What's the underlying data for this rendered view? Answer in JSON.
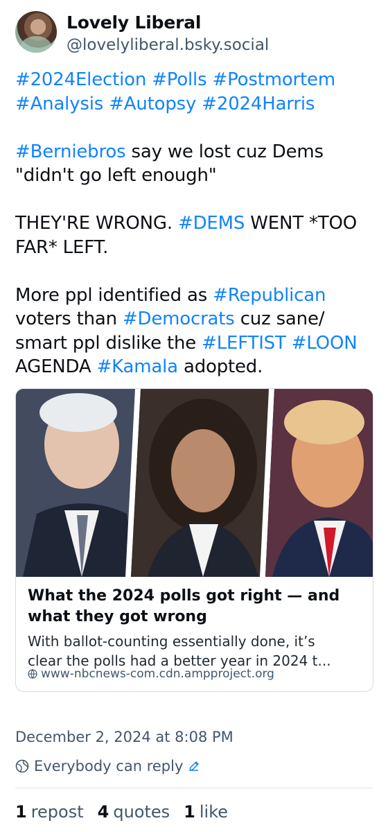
{
  "author": {
    "display_name": "Lovely Liberal",
    "handle": "@lovelyliberal.bsky.social"
  },
  "post": {
    "p1": [
      {
        "t": "#2024Election",
        "tag": true
      },
      {
        "t": " ",
        "tag": false
      },
      {
        "t": "#Polls",
        "tag": true
      },
      {
        "t": " ",
        "tag": false
      },
      {
        "t": "#Postmortem",
        "tag": true
      },
      {
        "t": " ",
        "tag": false
      },
      {
        "t": "#Analysis",
        "tag": true
      },
      {
        "t": " ",
        "tag": false
      },
      {
        "t": "#Autopsy",
        "tag": true
      },
      {
        "t": " ",
        "tag": false
      },
      {
        "t": "#2024Harris",
        "tag": true
      }
    ],
    "p2": [
      {
        "t": "#Berniebros",
        "tag": true
      },
      {
        "t": " say we lost cuz Dems \"didn't go left enough\"",
        "tag": false
      }
    ],
    "p3": [
      {
        "t": "THEY'RE WRONG. ",
        "tag": false
      },
      {
        "t": "#DEMS",
        "tag": true
      },
      {
        "t": " WENT *TOO FAR* LEFT.",
        "tag": false
      }
    ],
    "p4": [
      {
        "t": "More ppl identified as ",
        "tag": false
      },
      {
        "t": "#Republican",
        "tag": true
      },
      {
        "t": " voters than ",
        "tag": false
      },
      {
        "t": "#Democrats",
        "tag": true
      },
      {
        "t": " cuz sane/ smart ppl dislike the ",
        "tag": false
      },
      {
        "t": "#LEFTIST",
        "tag": true
      },
      {
        "t": " ",
        "tag": false
      },
      {
        "t": "#LOON",
        "tag": true
      },
      {
        "t": " AGENDA ",
        "tag": false
      },
      {
        "t": "#Kamala",
        "tag": true
      },
      {
        "t": " adopted.",
        "tag": false
      }
    ]
  },
  "link_card": {
    "title": "What the 2024 polls got right — and what they got wrong",
    "description_line1": "With ballot-counting essentially done, it’s",
    "description_line2": "clear the polls had a better year in 2024 t...",
    "domain": "www-nbcnews-com.cdn.ampproject.org",
    "icon": "globe-icon"
  },
  "meta": {
    "timestamp": "December 2, 2024 at 8:08 PM",
    "reply_setting": "Everybody can reply",
    "reply_icon": "globe-icon",
    "edit_icon": "pencil-icon"
  },
  "stats": {
    "reposts_count": "1",
    "reposts_label": "repost",
    "quotes_count": "4",
    "quotes_label": "quotes",
    "likes_count": "1",
    "likes_label": "like"
  },
  "colors": {
    "hashtag": "#1083fe",
    "muted": "#42566b",
    "text": "#0b0f14"
  }
}
